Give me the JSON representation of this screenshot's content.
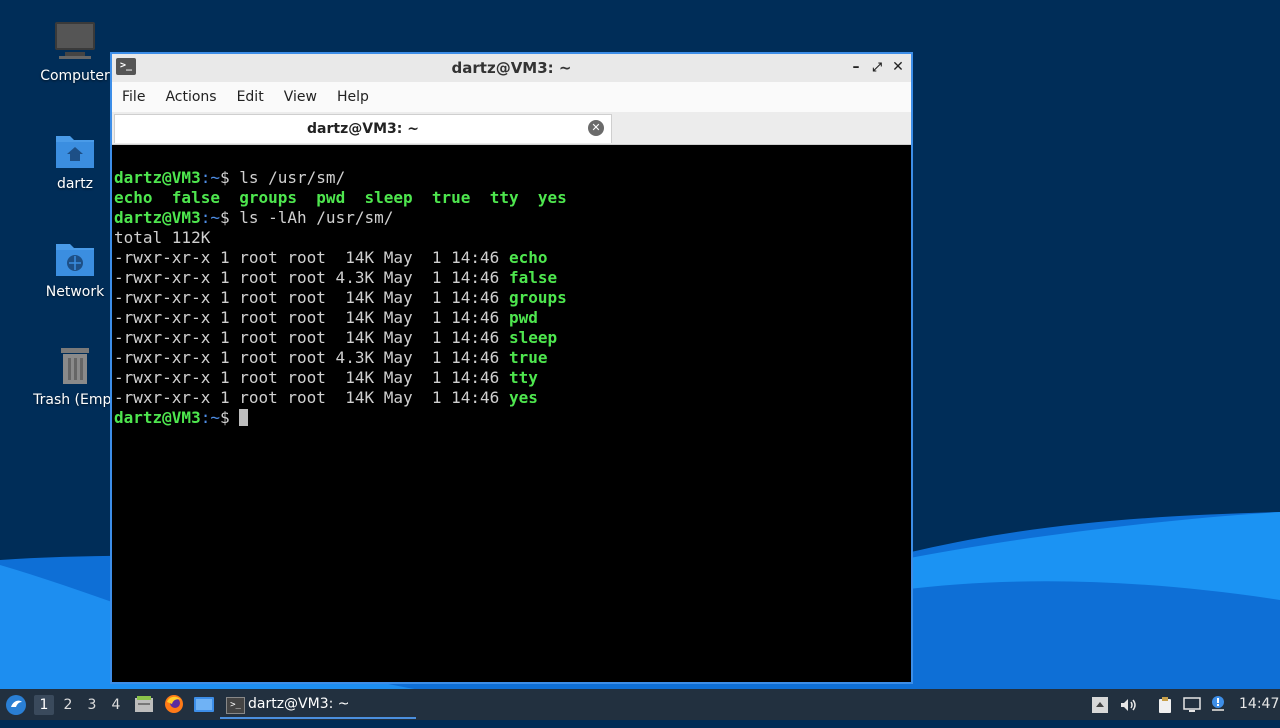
{
  "desktop": {
    "icons": [
      {
        "name": "computer-icon",
        "label": "Computer"
      },
      {
        "name": "home-folder-icon",
        "label": "dartz"
      },
      {
        "name": "network-folder-icon",
        "label": "Network"
      },
      {
        "name": "trash-icon",
        "label": "Trash (Empt"
      }
    ]
  },
  "window": {
    "title": "dartz@VM3: ~",
    "menu": [
      "File",
      "Actions",
      "Edit",
      "View",
      "Help"
    ],
    "tab_title": "dartz@VM3: ~"
  },
  "terminal": {
    "prompt_user": "dartz@VM3",
    "prompt_path": ":~",
    "prompt_symbol": "$ ",
    "cmd1": "ls /usr/sm/",
    "ls_output": [
      "echo",
      "false",
      "groups",
      "pwd",
      "sleep",
      "true",
      "tty",
      "yes"
    ],
    "cmd2": "ls -lAh /usr/sm/",
    "total": "total 112K",
    "long_listing": [
      {
        "meta": "-rwxr-xr-x 1 root root  14K May  1 14:46 ",
        "name": "echo"
      },
      {
        "meta": "-rwxr-xr-x 1 root root 4.3K May  1 14:46 ",
        "name": "false"
      },
      {
        "meta": "-rwxr-xr-x 1 root root  14K May  1 14:46 ",
        "name": "groups"
      },
      {
        "meta": "-rwxr-xr-x 1 root root  14K May  1 14:46 ",
        "name": "pwd"
      },
      {
        "meta": "-rwxr-xr-x 1 root root  14K May  1 14:46 ",
        "name": "sleep"
      },
      {
        "meta": "-rwxr-xr-x 1 root root 4.3K May  1 14:46 ",
        "name": "true"
      },
      {
        "meta": "-rwxr-xr-x 1 root root  14K May  1 14:46 ",
        "name": "tty"
      },
      {
        "meta": "-rwxr-xr-x 1 root root  14K May  1 14:46 ",
        "name": "yes"
      }
    ]
  },
  "taskbar": {
    "workspaces": [
      "1",
      "2",
      "3",
      "4"
    ],
    "active_workspace": "1",
    "task_label": "dartz@VM3: ~",
    "clock": "14:47"
  },
  "colors": {
    "prompt_green": "#4ee64e",
    "path_blue": "#4f8fe8",
    "window_border": "#3d8ee8",
    "taskbar_bg": "#22303f"
  }
}
